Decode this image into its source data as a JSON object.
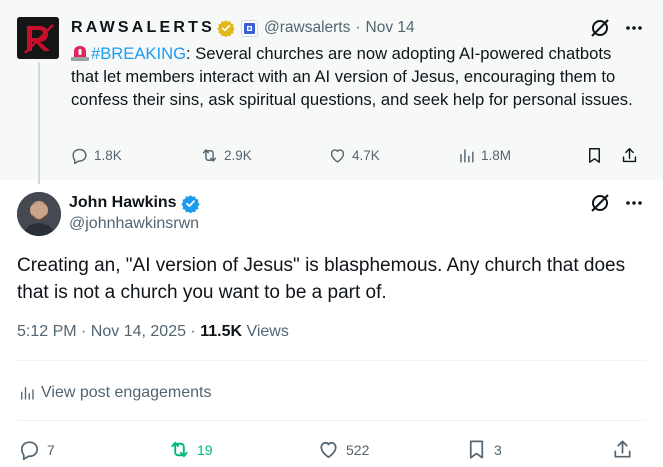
{
  "parent_tweet": {
    "author_name": "RAWSALERTS",
    "handle": "@rawsalerts",
    "separator": "·",
    "date": "Nov 14",
    "text_prefix_emoji": "siren-emoji",
    "hashtag": "#BREAKING",
    "text": ": Several churches are now adopting AI-powered chatbots that let members interact with an AI version of Jesus, encouraging them to confess their sins, ask spiritual questions, and seek help for personal issues.",
    "stats": {
      "replies": "1.8K",
      "reposts": "2.9K",
      "likes": "4.7K",
      "views": "1.8M"
    }
  },
  "main_tweet": {
    "author_name": "John Hawkins",
    "handle": "@johnhawkinsrwn",
    "text": "Creating an, \"AI version of Jesus\" is blasphemous. Any church that does that is not a church you want to be a part of.",
    "timestamp": "5:12 PM · Nov 14, 2025 · ",
    "views_count": "11.5K",
    "views_label": " Views",
    "engagements_link": "View post engagements",
    "stats": {
      "replies": "7",
      "reposts": "19",
      "likes": "522",
      "bookmarks": "3"
    }
  },
  "colors": {
    "accent": "#1d9bf0",
    "repost_active": "#00ba7c",
    "muted_text": "#536471",
    "parent_bg": "#f7f9f9",
    "gold_badge": "#e2b719"
  }
}
